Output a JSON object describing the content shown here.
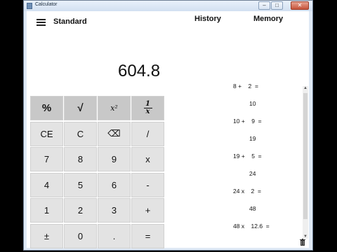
{
  "window": {
    "title": "Calculator",
    "min": "–",
    "max": "□",
    "close": "✕"
  },
  "header": {
    "mode": "Standard",
    "history_tab": "History",
    "memory_tab": "Memory"
  },
  "display": {
    "value": "604.8"
  },
  "keys": [
    [
      "%",
      "√",
      "x²",
      "1/x"
    ],
    [
      "CE",
      "C",
      "⌫",
      "/"
    ],
    [
      "7",
      "8",
      "9",
      "x"
    ],
    [
      "4",
      "5",
      "6",
      "-"
    ],
    [
      "1",
      "2",
      "3",
      "+"
    ],
    [
      "±",
      "0",
      ".",
      "="
    ]
  ],
  "history": [
    {
      "expr": "8 +    2  =",
      "result": "10"
    },
    {
      "expr": "10 +    9  =",
      "result": "19"
    },
    {
      "expr": "19 +    5  =",
      "result": "24"
    },
    {
      "expr": "24 x    2  =",
      "result": "48"
    },
    {
      "expr": "48 x    12.6  =",
      "result": ""
    }
  ],
  "icons": {
    "menu": "hamburger-icon",
    "delete_history": "trash-icon"
  }
}
